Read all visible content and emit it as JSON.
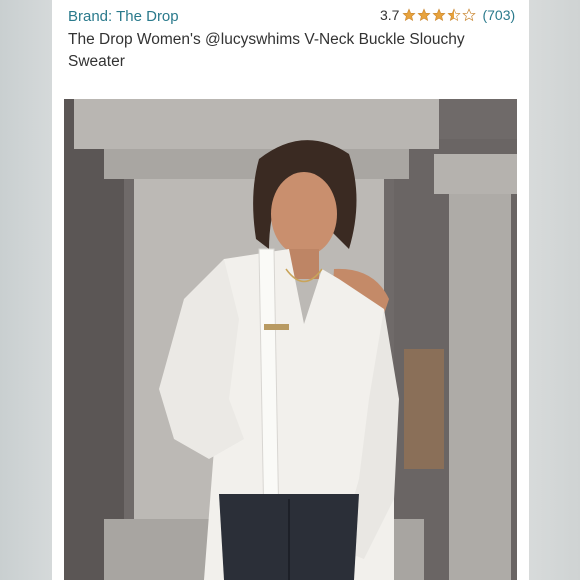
{
  "product": {
    "brand": "Brand: The Drop",
    "rating_value": "3.7",
    "rating_fraction": 0.74,
    "review_count": "(703)",
    "title": "The Drop Women's @lucyswhims V-Neck Buckle Slouchy Sweater"
  },
  "icons": {
    "star": "star-icon",
    "half_star": "half-star-icon",
    "empty_star": "empty-star-icon"
  },
  "colors": {
    "brand_link": "#2a7a8c",
    "star_fill": "#e8a33d"
  }
}
